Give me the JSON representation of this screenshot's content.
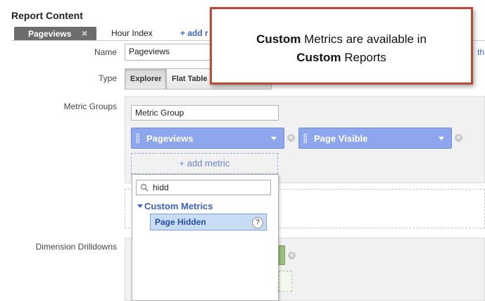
{
  "section_title": "Report Content",
  "tabs": [
    {
      "label": "Pageviews",
      "close": "×"
    },
    {
      "label": "Hour Index"
    },
    {
      "label": "+ add r"
    }
  ],
  "form": {
    "name_label": "Name",
    "name_value": "Pageviews",
    "name_right_fragment": "th",
    "type_label": "Type",
    "type_options": [
      "Explorer",
      "Flat Table"
    ],
    "metric_groups_label": "Metric Groups",
    "metric_group_name": "Metric Group",
    "metrics": [
      {
        "name": "Pageviews"
      },
      {
        "name": "Page Visible"
      }
    ],
    "add_metric_label": "+ add metric",
    "dimension_drilldowns_label": "Dimension Drilldowns"
  },
  "dropdown": {
    "search_value": "hidd",
    "category": "Custom Metrics",
    "option": "Page Hidden",
    "help_icon": "?"
  },
  "callout": {
    "line1_bold": "Custom",
    "line1_rest": " Metrics are available in",
    "line2_bold": "Custom",
    "line2_rest": " Reports"
  },
  "colors": {
    "metric_pill": "#8ea6ee",
    "callout_border": "#b94a3a",
    "dimension_pill": "#9cc07a"
  }
}
